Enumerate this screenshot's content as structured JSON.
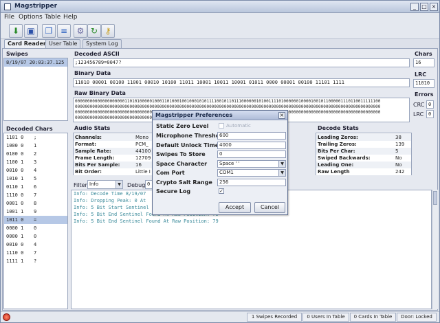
{
  "window": {
    "title": "Magstripper"
  },
  "menu": [
    "File",
    "Options",
    "Table",
    "Help"
  ],
  "toolbar": {
    "icons": [
      "load-icon",
      "save-icon",
      "copy-icon",
      "document-icon",
      "settings-icon",
      "refresh-icon",
      "key-icon"
    ]
  },
  "tabs": [
    {
      "label": "Card Reader",
      "active": true
    },
    {
      "label": "User Table"
    },
    {
      "label": "System Log"
    }
  ],
  "swipes": {
    "label": "Swipes",
    "items": [
      "8/19/07 20:03:37.125"
    ]
  },
  "decoded_ascii": {
    "label": "Decoded ASCII",
    "value": ";123456789=0047?"
  },
  "chars": {
    "label": "Chars",
    "value": "16"
  },
  "binary_data": {
    "label": "Binary Data",
    "value": "11010 00001 00100 11001 00010 10100 11011 10001 10011 10001 01011 0000 00001 00100 11101 1111"
  },
  "lrc": {
    "label": "LRC",
    "value": "11010"
  },
  "raw_binary": {
    "label": "Raw Binary Data",
    "lines": [
      "000000000000000000001101010000010001101000100100010101111001011011100000010100111101000000100001001011000001110110011111100",
      "000000000000000000000000000000000000000000000000000000000000000000000000000000000000000000000000000000000000000000000000000",
      "000000000000000000000000000000000000000000000000000000000000000000000000000000000000000000000000000000000000000000000000000",
      "00000000000000000000000000000000000"
    ]
  },
  "errors": {
    "label": "Errors",
    "crc_label": "CRC",
    "crc": "0",
    "lrc_label": "LRC",
    "lrc": "0"
  },
  "decoded_chars": {
    "label": "Decoded Chars",
    "rows": [
      {
        "bits": "1101 0",
        "char": ";"
      },
      {
        "bits": "1000 0",
        "char": "1"
      },
      {
        "bits": "0100 0",
        "char": "2"
      },
      {
        "bits": "1100 1",
        "char": "3"
      },
      {
        "bits": "0010 0",
        "char": "4"
      },
      {
        "bits": "1010 1",
        "char": "5"
      },
      {
        "bits": "0110 1",
        "char": "6"
      },
      {
        "bits": "1110 0",
        "char": "7"
      },
      {
        "bits": "0001 0",
        "char": "8"
      },
      {
        "bits": "1001 1",
        "char": "9"
      },
      {
        "bits": "1011 0",
        "char": "=",
        "selected": true
      },
      {
        "bits": "0000 1",
        "char": "0"
      },
      {
        "bits": "0000 1",
        "char": "0"
      },
      {
        "bits": "0010 0",
        "char": "4"
      },
      {
        "bits": "1110 0",
        "char": "7"
      },
      {
        "bits": "1111 1",
        "char": "?"
      }
    ]
  },
  "audio_stats": {
    "label": "Audio Stats",
    "rows": [
      {
        "k": "Channels:",
        "v": "Mono"
      },
      {
        "k": "Format:",
        "v": "PCM_"
      },
      {
        "k": "Sample Rate:",
        "v": "44100"
      },
      {
        "k": "Frame Length:",
        "v": "12709"
      },
      {
        "k": "Bits Per Sample:",
        "v": "16"
      },
      {
        "k": "Bit Order:",
        "v": "Little I"
      }
    ]
  },
  "decode_stats": {
    "label": "Decode Stats",
    "rows": [
      {
        "k": "Leading Zeros:",
        "v": "38"
      },
      {
        "k": "Trailing Zeros:",
        "v": "139"
      },
      {
        "k": "Bits Per Char:",
        "v": "5"
      },
      {
        "k": "Swiped Backwards:",
        "v": "No"
      },
      {
        "k": "Leading One:",
        "v": "No"
      },
      {
        "k": "Raw Length",
        "v": "242"
      }
    ]
  },
  "filter": {
    "label": "Filter",
    "value": "Info",
    "debug_label": "Debug",
    "debug_value": "0"
  },
  "log_lines": [
    "Info: Decode Time 8/19/07",
    "Info: Dropping Peak: 0 At",
    "Info: 5 Bit Start Sentinel",
    "Info: 5 Bit End Sentinel Found At Raw Position: 75",
    "Info: 5 Bit End Sentinel Found At Raw Position: 79"
  ],
  "dialog": {
    "title": "Magstripper Preferences",
    "static_zero_level": {
      "label": "Static Zero Level",
      "checkbox_label": "Automatic"
    },
    "mic_threshold": {
      "label": "Microphone Thresholds",
      "value": "600"
    },
    "unlock_time": {
      "label": "Default Unlock Time",
      "value": "4000"
    },
    "swipes_to_store": {
      "label": "Swipes To Store",
      "value": "0"
    },
    "space_char": {
      "label": "Space Character",
      "value": "Space ' '"
    },
    "com_port": {
      "label": "Com Port",
      "value": "COM1"
    },
    "salt_range": {
      "label": "Crypto Salt Range",
      "value": "256"
    },
    "secure_log": {
      "label": "Secure Log",
      "checked": true
    },
    "accept_label": "Accept",
    "cancel_label": "Cancel"
  },
  "status": {
    "swipes": "1 Swipes Recorded",
    "users": "0 Users In Table",
    "cards": "0 Cards In Table",
    "door": "Door: Locked"
  }
}
